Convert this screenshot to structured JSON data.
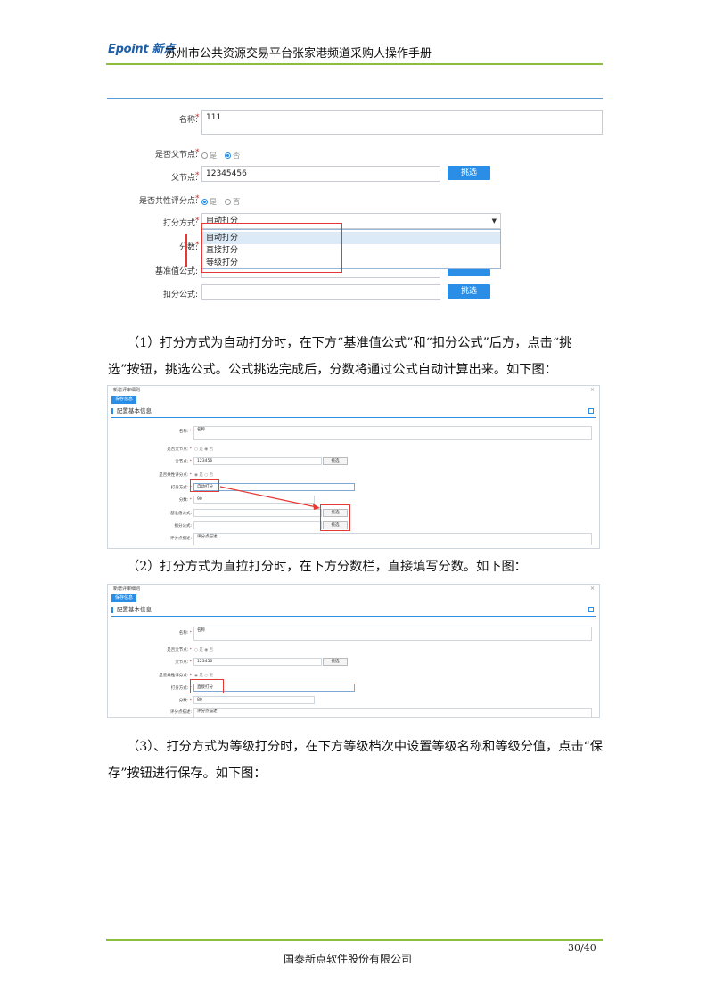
{
  "header": {
    "logo": "Epoint 新点",
    "title": "苏州市公共资源交易平台张家港频道采购人操作手册"
  },
  "shot1": {
    "name_label": "名称:",
    "name_value": "111",
    "is_parent_label": "是否父节点:",
    "is_parent_yes": "是",
    "is_parent_no": "否",
    "parent_label": "父节点:",
    "parent_value": "12345456",
    "pick_btn": "挑选",
    "shared_label": "是否共性评分点:",
    "shared_yes": "是",
    "shared_no": "否",
    "mode_label": "打分方式:",
    "mode_value": "自动打分",
    "score_label": "分数:",
    "base_label": "基准值公式:",
    "deduct_label": "扣分公式:",
    "options": [
      "自动打分",
      "直接打分",
      "等级打分"
    ],
    "pick_btn2": "挑选"
  },
  "paragraphs": {
    "p1_line1": "（1）打分方式为自动打分时，在下方“基准值公式”和“扣分公式”后方，点击“挑",
    "p1_line2": "选”按钮，挑选公式。公式挑选完成后，分数将通过公式自动计算出来。如下图：",
    "p2": "（2）打分方式为直拉打分时，在下方分数栏，直接填写分数。如下图：",
    "p3_line1": "（3）、打分方式为等级打分时，在下方等级档次中设置等级名称和等级分值，点击“保",
    "p3_line2": "存”按钮进行保存。如下图："
  },
  "shot2": {
    "dialog_title": "新增评审细则",
    "close": "×",
    "save_btn": "保存信息",
    "section": "配置基本信息",
    "name_label": "名称:",
    "name_value": "名称",
    "is_parent_label": "是否父节点:",
    "parent_label": "父节点:",
    "parent_value": "123456",
    "pick": "挑选",
    "shared_label": "是否共性评分点:",
    "mode_label": "打分方式:",
    "mode_value": "自动打分",
    "score_label": "分数:",
    "score_value": "90",
    "base_label": "基准值公式:",
    "deduct_label": "扣分公式:",
    "desc_label": "评分点描述:",
    "desc_value": "评分点描述"
  },
  "shot3": {
    "dialog_title": "新增评审细则",
    "close": "×",
    "save_btn": "保存信息",
    "section": "配置基本信息",
    "name_label": "名称:",
    "name_value": "名称",
    "is_parent_label": "是否父节点:",
    "parent_label": "父节点:",
    "parent_value": "123456",
    "pick": "挑选",
    "shared_label": "是否共性评分点:",
    "mode_label": "打分方式:",
    "mode_value": "直接打分",
    "score_label": "分数:",
    "score_value": "80",
    "desc_label": "评分点描述:",
    "desc_value": "评分点描述"
  },
  "footer": {
    "page": "30/40",
    "company": "国泰新点软件股份有限公司"
  }
}
